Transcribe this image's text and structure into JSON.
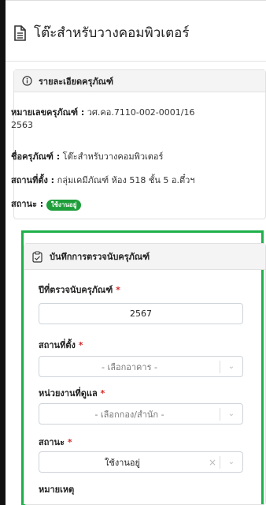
{
  "header": {
    "title": "โต๊ะสำหรับวางคอมพิวเตอร์",
    "icon": "document-icon"
  },
  "details_card": {
    "heading": "รายละเอียดครุภัณฑ์",
    "asset_number_label": "หมายเลขครุภัณฑ์ :",
    "asset_number_value": "วศ.คอ.7110-002-0001/16",
    "asset_number_year": "2563",
    "name_label": "ชื่อครุภัณฑ์ :",
    "name_value": "โต๊ะสำหรับวางคอมพิวเตอร์",
    "location_label": "สถานที่ตั้ง :",
    "location_value": "กลุ่มเคมีภัณฑ์ ห้อง 518 ชั้น 5 อ.ตึ๋วฯ",
    "status_label": "สถานะ :",
    "status_badge": "ใช้งานอยู่",
    "status_color": "#1e9e3a"
  },
  "inspection_card": {
    "heading": "บันทึกการตรวจนับครุภัณฑ์",
    "year_label": "ปีที่ตรวจนับครุภัณฑ์",
    "year_value": "2567",
    "location_label": "สถานที่ตั้ง",
    "location_placeholder": "- เลือกอาคาร -",
    "department_label": "หน่วยงานที่ดูแล",
    "department_placeholder": "- เลือกกอง/สำนัก -",
    "status_label": "สถานะ",
    "status_value": "ใช้งานอยู่",
    "note_label": "หมายเหตุ",
    "required_mark": "*",
    "highlight_color": "#1eb04a"
  }
}
